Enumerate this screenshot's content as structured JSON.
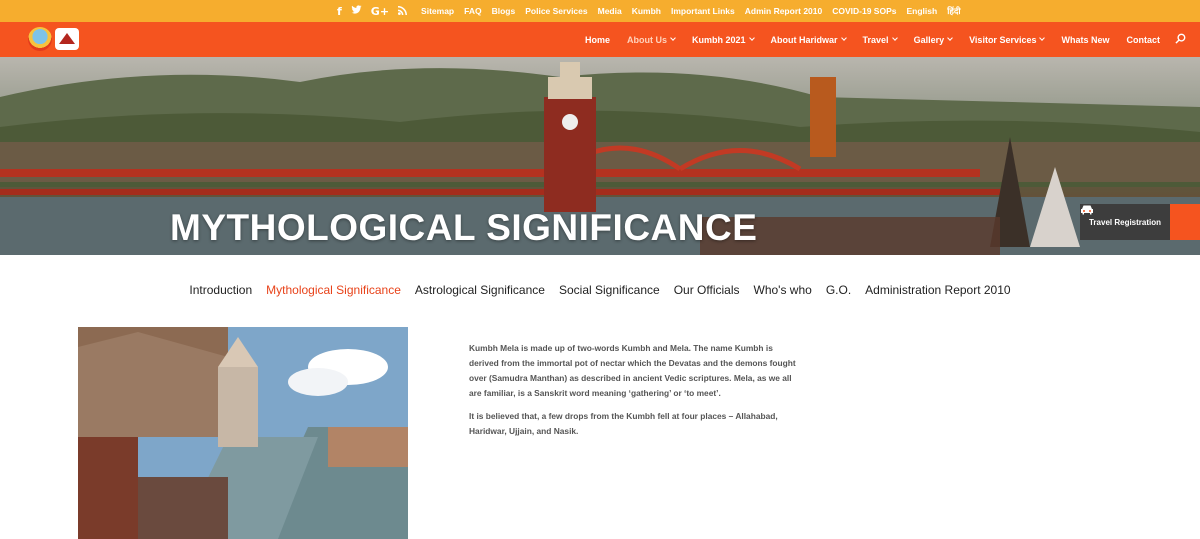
{
  "topbar": {
    "social": [
      {
        "icon": "facebook-icon",
        "glyph": "f"
      },
      {
        "icon": "twitter-icon",
        "glyph": "t"
      },
      {
        "icon": "google-plus-icon",
        "glyph": "G+"
      },
      {
        "icon": "rss-icon",
        "glyph": "◉"
      }
    ],
    "links": [
      "Sitemap",
      "FAQ",
      "Blogs",
      "Police Services",
      "Media",
      "Kumbh",
      "Important Links",
      "Admin Report 2010",
      "COVID-19 SOPs",
      "English",
      "हिंदी"
    ]
  },
  "nav": {
    "items": [
      {
        "label": "Home",
        "dropdown": false
      },
      {
        "label": "About Us",
        "dropdown": true,
        "active": true
      },
      {
        "label": "Kumbh 2021",
        "dropdown": true
      },
      {
        "label": "About Haridwar",
        "dropdown": true
      },
      {
        "label": "Travel",
        "dropdown": true
      },
      {
        "label": "Gallery",
        "dropdown": true
      },
      {
        "label": "Visitor Services",
        "dropdown": true
      },
      {
        "label": "Whats New",
        "dropdown": false
      },
      {
        "label": "Contact",
        "dropdown": false
      }
    ]
  },
  "hero": {
    "title": "MYTHOLOGICAL SIGNIFICANCE",
    "travel_registration": "Travel Registration"
  },
  "subnav": {
    "items": [
      {
        "label": "Introduction"
      },
      {
        "label": "Mythological Significance",
        "active": true
      },
      {
        "label": "Astrological Significance"
      },
      {
        "label": "Social Significance"
      },
      {
        "label": "Our Officials"
      },
      {
        "label": "Who's who"
      },
      {
        "label": "G.O."
      },
      {
        "label": "Administration Report 2010"
      }
    ]
  },
  "content": {
    "paragraphs": [
      "Kumbh Mela is made up of two-words Kumbh and Mela. The name Kumbh is derived from the immortal pot of nectar which the Devatas and the demons fought over (Samudra Manthan) as described in ancient Vedic scriptures. Mela, as we all are familiar, is a Sanskrit word meaning ‘gathering’ or ‘to meet’.",
      "It is believed that, a few drops from the Kumbh fell at four places – Allahabad, Haridwar, Ujjain, and Nasik."
    ]
  },
  "colors": {
    "topbar": "#f6ad2e",
    "nav": "#f5541f",
    "active_link": "#e8431a"
  }
}
